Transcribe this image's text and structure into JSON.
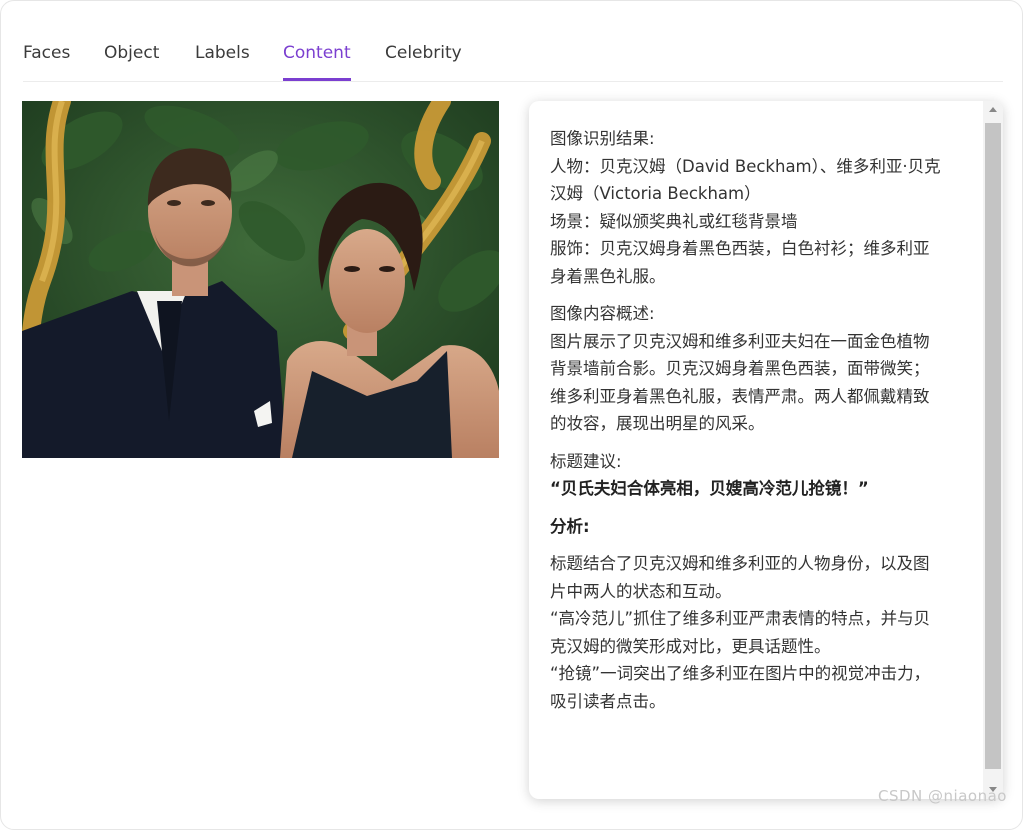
{
  "tabs": [
    {
      "label": "Faces"
    },
    {
      "label": "Object"
    },
    {
      "label": "Labels"
    },
    {
      "label": "Content",
      "active": true
    },
    {
      "label": "Celebrity"
    }
  ],
  "result": {
    "recognition_title": "图像识别结果:",
    "person_line1": "人物：贝克汉姆（David Beckham）、维多利亚·贝克",
    "person_line2": "汉姆（Victoria Beckham）",
    "scene": "场景：疑似颁奖典礼或红毯背景墙",
    "clothing_line1": "服饰：贝克汉姆身着黑色西装，白色衬衫；维多利亚",
    "clothing_line2": "身着黑色礼服。",
    "summary_title": "图像内容概述:",
    "summary_line1": "图片展示了贝克汉姆和维多利亚夫妇在一面金色植物",
    "summary_line2": "背景墙前合影。贝克汉姆身着黑色西装，面带微笑；",
    "summary_line3": "维多利亚身着黑色礼服，表情严肃。两人都佩戴精致",
    "summary_line4": "的妆容，展现出明星的风采。",
    "headline_title": "标题建议:",
    "headline": "“贝氏夫妇合体亮相，贝嫂高冷范儿抢镜！”",
    "analysis_title": "分析:",
    "analysis_line1": "标题结合了贝克汉姆和维多利亚的人物身份，以及图",
    "analysis_line2": "片中两人的状态和互动。",
    "analysis_line3": "“高冷范儿”抓住了维多利亚严肃表情的特点，并与贝",
    "analysis_line4": "克汉姆的微笑形成对比，更具话题性。",
    "analysis_line5": "“抢镜”一词突出了维多利亚在图片中的视觉冲击力，",
    "analysis_line6": "吸引读者点击。"
  },
  "watermark": "CSDN @niaonao",
  "colors": {
    "accent": "#7b3fd0"
  }
}
